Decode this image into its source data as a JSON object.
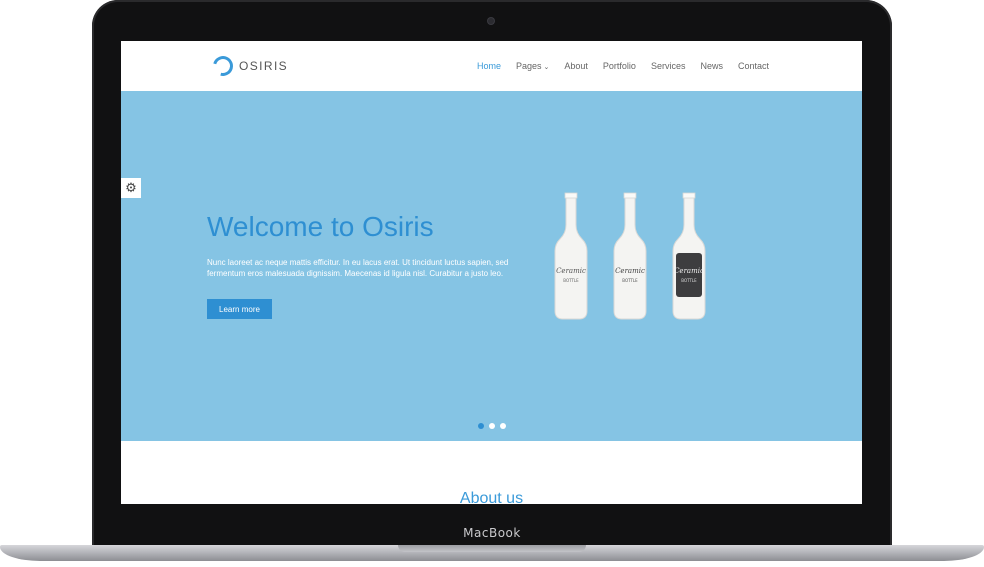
{
  "device": {
    "label": "MacBook"
  },
  "site": {
    "brand": "OSIRIS",
    "nav": [
      "Home",
      "Pages",
      "About",
      "Portfolio",
      "Services",
      "News",
      "Contact"
    ]
  },
  "hero": {
    "title": "Welcome to Osiris",
    "text": "Nunc laoreet ac neque mattis efficitur. In eu lacus erat. Ut tincidunt luctus sapien, sed fermentum eros malesuada dignissim. Maecenas id ligula nisl. Curabitur a justo leo.",
    "button": "Learn more",
    "bottle_label": "Ceramic",
    "bottle_sub": "BOTTLE"
  },
  "about": {
    "title": "About us"
  },
  "colors": {
    "accent": "#2e8fd2",
    "hero_bg": "#85c4e4"
  }
}
